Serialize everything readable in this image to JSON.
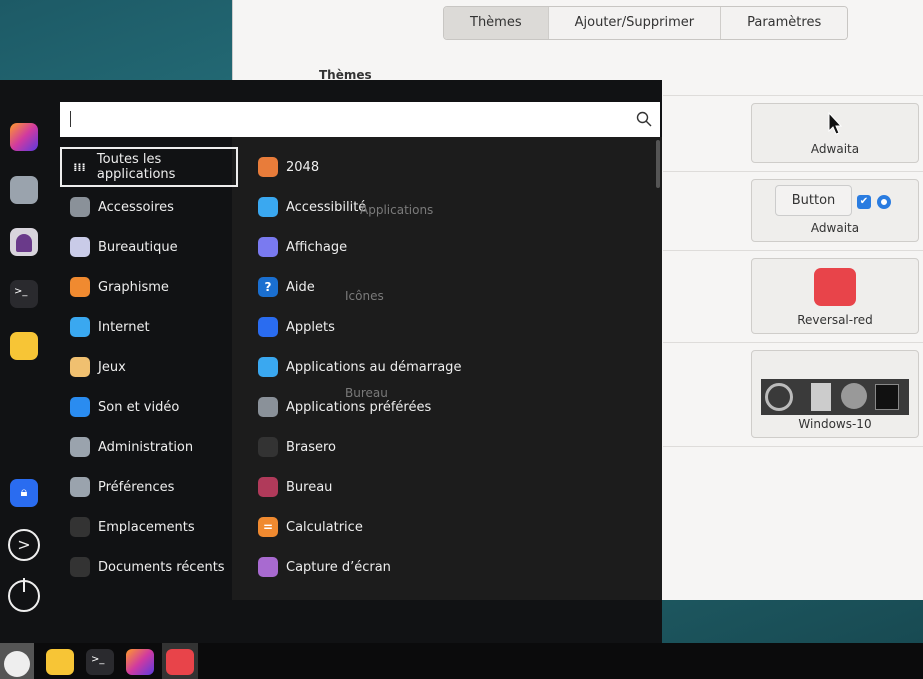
{
  "window": {
    "tabs": [
      {
        "label": "Thèmes",
        "active": true
      },
      {
        "label": "Ajouter/Supprimer"
      },
      {
        "label": "Paramètres"
      }
    ],
    "section_title": "Thèmes",
    "row_labels": [
      "Applications",
      "Icônes",
      "Bureau"
    ],
    "cards": [
      {
        "label": "Adwaita"
      },
      {
        "label": "Adwaita",
        "button_label": "Button"
      },
      {
        "label": "Reversal-red"
      },
      {
        "label": "Windows-10"
      }
    ]
  },
  "menu": {
    "search": {
      "value": "",
      "icon": "search-icon"
    },
    "favorites": [
      "firefox",
      "system-settings",
      "pidgin",
      "terminal",
      "files"
    ],
    "session": [
      "lock-icon",
      "logout-icon",
      "power-icon"
    ],
    "categories": [
      {
        "label": "Toutes les applications",
        "icon": "grid-icon",
        "selected": true
      },
      {
        "label": "Accessoires",
        "color": "#8a9199"
      },
      {
        "label": "Bureautique",
        "color": "#c9cbe8"
      },
      {
        "label": "Graphisme",
        "color": "#f08a30"
      },
      {
        "label": "Internet",
        "color": "#3aa8f0"
      },
      {
        "label": "Jeux",
        "color": "#f0c070"
      },
      {
        "label": "Son et vidéo",
        "color": "#2a8cf0"
      },
      {
        "label": "Administration",
        "color": "#9aa3ad"
      },
      {
        "label": "Préférences",
        "color": "#9aa3ad"
      },
      {
        "label": "Emplacements",
        "color": "#333"
      },
      {
        "label": "Documents récents",
        "color": "#333"
      }
    ],
    "apps": [
      {
        "label": "2048",
        "color": "#e87c3a"
      },
      {
        "label": "Accessibilité",
        "color": "#3aa8f0"
      },
      {
        "label": "Affichage",
        "color": "#7a7af0"
      },
      {
        "label": "Aide",
        "color": "#1a6fd0",
        "glyph": "?"
      },
      {
        "label": "Applets",
        "color": "#2a6cf0"
      },
      {
        "label": "Applications au démarrage",
        "color": "#3aa8f0"
      },
      {
        "label": "Applications préférées",
        "color": "#8a9199"
      },
      {
        "label": "Brasero",
        "color": "#333"
      },
      {
        "label": "Bureau",
        "color": "#b03a5a"
      },
      {
        "label": "Calculatrice",
        "color": "#f08a30",
        "glyph": "="
      },
      {
        "label": "Capture d’écran",
        "color": "#a86ad0"
      }
    ]
  },
  "taskbar": {
    "items": [
      "menu",
      "files",
      "terminal",
      "firefox",
      "app-red"
    ]
  }
}
